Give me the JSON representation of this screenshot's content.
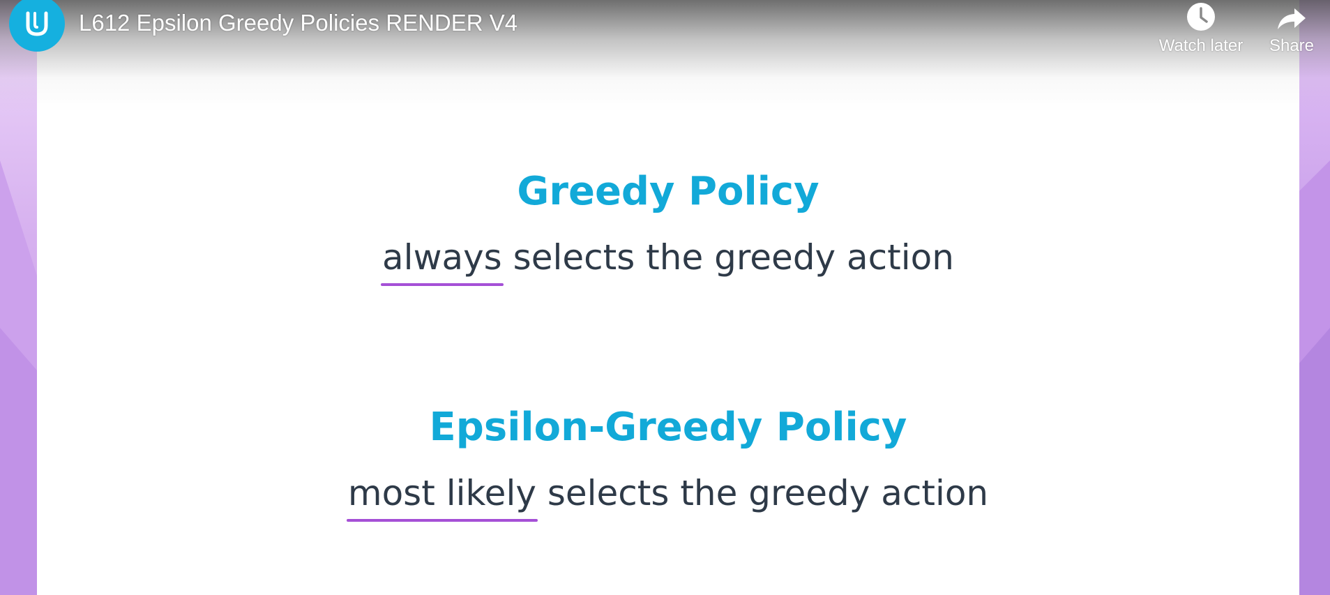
{
  "video": {
    "title": "L612 Epsilon Greedy Policies RENDER V4",
    "channel_logo": "udacity-logo-icon"
  },
  "controls": {
    "watch_later_label": "Watch later",
    "watch_later_icon": "clock-icon",
    "share_label": "Share",
    "share_icon": "share-arrow-icon"
  },
  "slide": {
    "sections": [
      {
        "heading": "Greedy Policy",
        "emphasis": "always",
        "rest": " selects the greedy action"
      },
      {
        "heading": "Epsilon-Greedy Policy",
        "emphasis": "most likely",
        "rest": " selects the greedy action"
      }
    ]
  },
  "colors": {
    "heading": "#12a9d8",
    "body_text": "#2e3a48",
    "underline": "#a550d6",
    "logo_bg": "#15b0df",
    "background": "#c59be6"
  }
}
